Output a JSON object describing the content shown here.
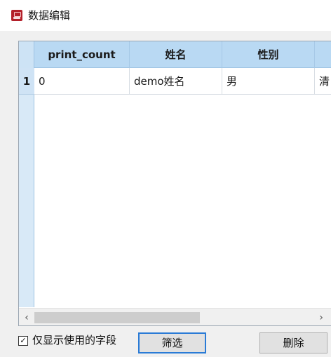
{
  "window": {
    "title": "数据编辑",
    "icon": "app-logo-icon"
  },
  "grid": {
    "columns": [
      "print_count",
      "姓名",
      "性别",
      ""
    ],
    "rows": [
      {
        "num": "1",
        "cells": [
          "0",
          "demo姓名",
          "男",
          "清"
        ]
      }
    ]
  },
  "scrollbar": {
    "left_arrow": "‹",
    "right_arrow": "›"
  },
  "footer": {
    "checkbox_checked": true,
    "checkbox_mark": "✓",
    "checkbox_label": "仅显示使用的字段",
    "filter_button": "筛选",
    "delete_button": "删除"
  },
  "colors": {
    "header_bg": "#b9d9f3",
    "primary_border": "#2a7bd6"
  }
}
